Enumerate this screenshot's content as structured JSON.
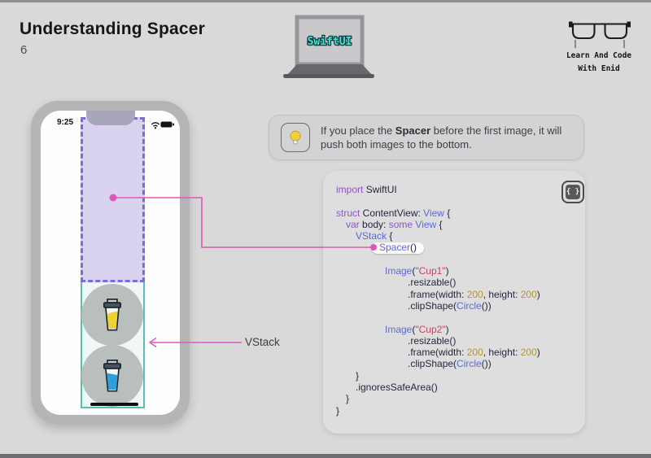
{
  "page": {
    "title": "Understanding Spacer",
    "slide_number": "6"
  },
  "brand": {
    "laptop_label": "SwiftUI",
    "tagline_line1": "Learn And Code",
    "tagline_line2": "With Enid"
  },
  "tip": {
    "before": "If you place the ",
    "bold": "Spacer",
    "after": " before the first image, it will push both images to the bottom."
  },
  "phone": {
    "status_time": "9:25"
  },
  "annotations": {
    "vstack_label": "VStack"
  },
  "code": {
    "button_glyph": "{ }",
    "lines": [
      {
        "indent": 0,
        "tokens": [
          [
            "import ",
            "kw"
          ],
          [
            "SwiftUI",
            "plain"
          ]
        ]
      },
      {
        "indent": 0,
        "tokens": []
      },
      {
        "indent": 0,
        "tokens": [
          [
            "struct ",
            "kw"
          ],
          [
            "ContentView",
            "plain"
          ],
          [
            ": ",
            "plain"
          ],
          [
            "View",
            "type"
          ],
          [
            " {",
            "plain"
          ]
        ]
      },
      {
        "indent": 12,
        "tokens": [
          [
            "var ",
            "kw"
          ],
          [
            "body: ",
            "plain"
          ],
          [
            "some ",
            "kw"
          ],
          [
            "View",
            "type"
          ],
          [
            " {",
            "plain"
          ]
        ]
      },
      {
        "indent": 24,
        "tokens": [
          [
            "VStack",
            "type"
          ],
          [
            " {",
            "plain"
          ]
        ]
      },
      {
        "indent": 44,
        "pill": true,
        "tokens": [
          [
            "Spacer",
            "type"
          ],
          [
            "()",
            "plain"
          ]
        ]
      },
      {
        "indent": 0,
        "tokens": []
      },
      {
        "indent": 60,
        "tokens": [
          [
            "Image",
            "type"
          ],
          [
            "(",
            "plain"
          ],
          [
            "\"Cup1\"",
            "str"
          ],
          [
            ")",
            "plain"
          ]
        ]
      },
      {
        "indent": 88,
        "tokens": [
          [
            ".resizable()",
            "plain"
          ]
        ]
      },
      {
        "indent": 88,
        "tokens": [
          [
            ".frame(width: ",
            "plain"
          ],
          [
            "200",
            "num"
          ],
          [
            ", height: ",
            "plain"
          ],
          [
            "200",
            "num"
          ],
          [
            ")",
            "plain"
          ]
        ]
      },
      {
        "indent": 88,
        "tokens": [
          [
            ".clipShape(",
            "plain"
          ],
          [
            "Circle",
            "type"
          ],
          [
            "())",
            "plain"
          ]
        ]
      },
      {
        "indent": 0,
        "tokens": []
      },
      {
        "indent": 60,
        "tokens": [
          [
            "Image",
            "type"
          ],
          [
            "(",
            "plain"
          ],
          [
            "\"Cup2\"",
            "str"
          ],
          [
            ")",
            "plain"
          ]
        ]
      },
      {
        "indent": 88,
        "tokens": [
          [
            ".resizable()",
            "plain"
          ]
        ]
      },
      {
        "indent": 88,
        "tokens": [
          [
            ".frame(width: ",
            "plain"
          ],
          [
            "200",
            "num"
          ],
          [
            ", height: ",
            "plain"
          ],
          [
            "200",
            "num"
          ],
          [
            ")",
            "plain"
          ]
        ]
      },
      {
        "indent": 88,
        "tokens": [
          [
            ".clipShape(",
            "plain"
          ],
          [
            "Circle",
            "type"
          ],
          [
            "())",
            "plain"
          ]
        ]
      },
      {
        "indent": 24,
        "tokens": [
          [
            "}",
            "plain"
          ]
        ]
      },
      {
        "indent": 24,
        "tokens": [
          [
            ".ignoresSafeArea()",
            "plain"
          ]
        ]
      },
      {
        "indent": 12,
        "tokens": [
          [
            "}",
            "plain"
          ]
        ]
      },
      {
        "indent": 0,
        "tokens": [
          [
            "}",
            "plain"
          ]
        ]
      }
    ]
  },
  "colors": {
    "page_background": "#d9d9d9",
    "accent_pink": "#de58b9",
    "teal_border": "#57beb3",
    "spacer_fill": "#d9d3f0",
    "spacer_dash": "#7b6cd6",
    "code_keyword": "#9152c8",
    "code_type": "#5a6ad8",
    "code_plain": "#26263f",
    "code_string": "#c4495f",
    "code_number": "#b3952f",
    "laptop_text": "#41e3cd",
    "cup1_liquid": "#ecd235",
    "cup2_liquid": "#2e9fd8"
  }
}
